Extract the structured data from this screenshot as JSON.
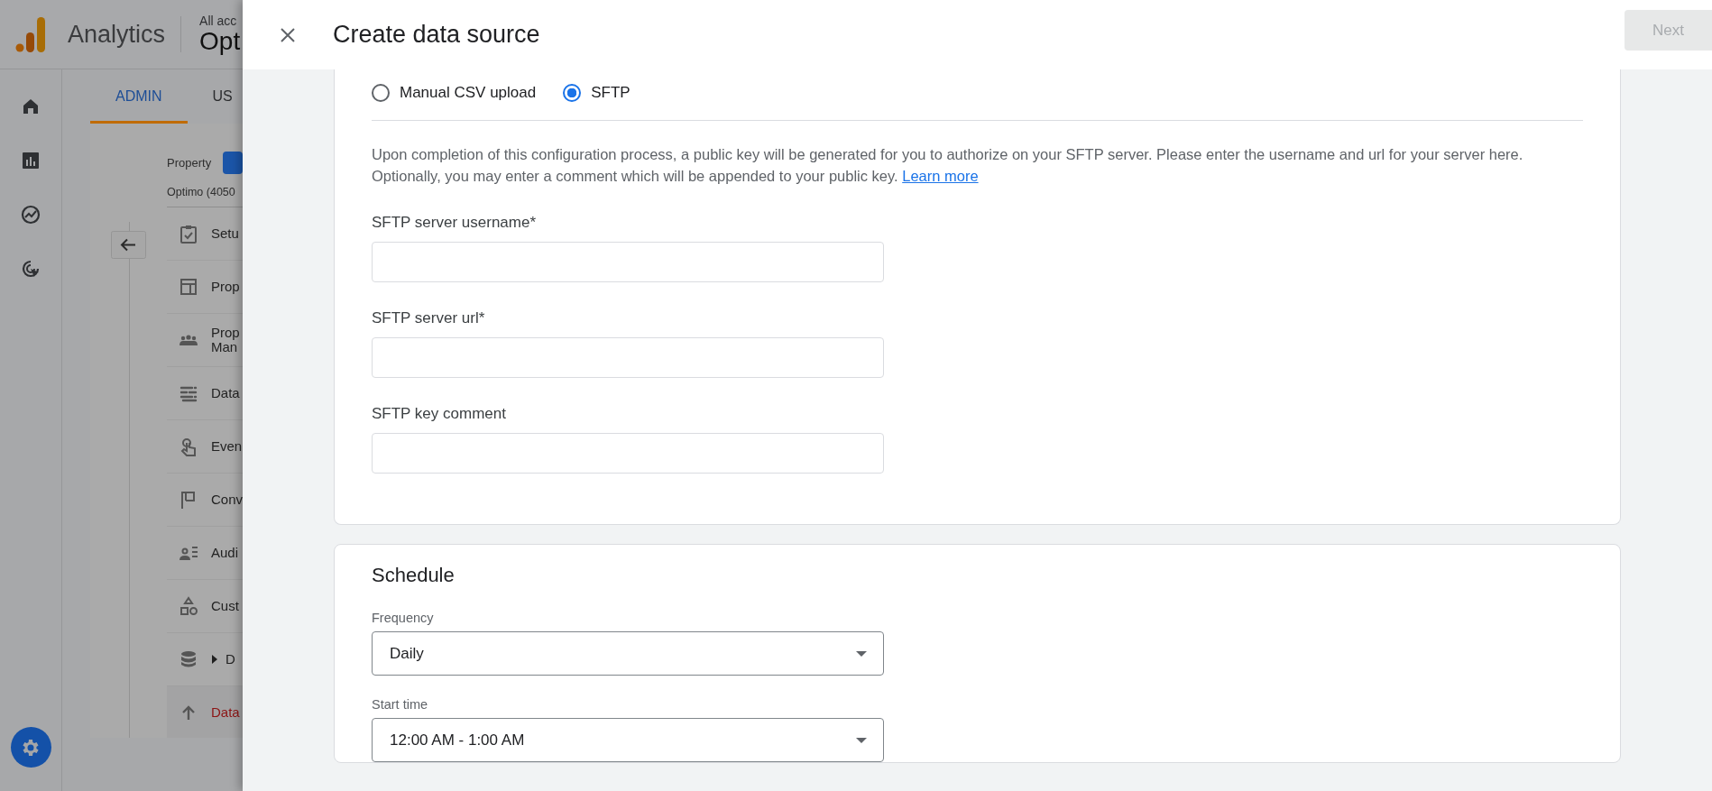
{
  "app": {
    "logo_text": "Analytics",
    "account_caption": "All acc",
    "account_name": "Opt",
    "tabs": [
      {
        "label": "ADMIN",
        "selected": true
      },
      {
        "label": "US",
        "selected": false
      }
    ],
    "property_label": "Property",
    "property_name": "Optimo (4050",
    "nav_items": [
      {
        "lines": [
          "Setu"
        ],
        "kind": "link",
        "selected": false
      },
      {
        "lines": [
          "Prop"
        ],
        "kind": "link",
        "selected": false
      },
      {
        "lines": [
          "Prop",
          "Man"
        ],
        "kind": "link",
        "selected": false
      },
      {
        "lines": [
          "Data"
        ],
        "kind": "link",
        "selected": false
      },
      {
        "lines": [
          "Even"
        ],
        "kind": "link",
        "selected": false
      },
      {
        "lines": [
          "Conv"
        ],
        "kind": "link",
        "selected": false
      },
      {
        "lines": [
          "Audi"
        ],
        "kind": "link",
        "selected": false
      },
      {
        "lines": [
          "Cust"
        ],
        "kind": "link",
        "selected": false
      },
      {
        "lines": [
          "D"
        ],
        "kind": "group",
        "expanded": false,
        "selected": false
      },
      {
        "lines": [
          "Data"
        ],
        "kind": "link",
        "selected": true
      }
    ]
  },
  "dialog": {
    "title": "Create data source",
    "next_button": {
      "label": "Next",
      "disabled": true
    },
    "source_options": [
      {
        "label": "Manual CSV upload",
        "selected": false
      },
      {
        "label": "SFTP",
        "selected": true
      }
    ],
    "description": "Upon completion of this configuration process, a public key will be generated for you to authorize on your SFTP server. Please enter the username and url for your server here. Optionally, you may enter a comment which will be appended to your public key.",
    "learn_more": "Learn more",
    "fields": [
      {
        "label": "SFTP server username*"
      },
      {
        "label": "SFTP server url*"
      },
      {
        "label": "SFTP key comment"
      }
    ],
    "schedule": {
      "title": "Schedule",
      "selects": [
        {
          "label": "Frequency",
          "value": "Daily"
        },
        {
          "label": "Start time",
          "value": "12:00 AM - 1:00 AM"
        }
      ]
    }
  }
}
